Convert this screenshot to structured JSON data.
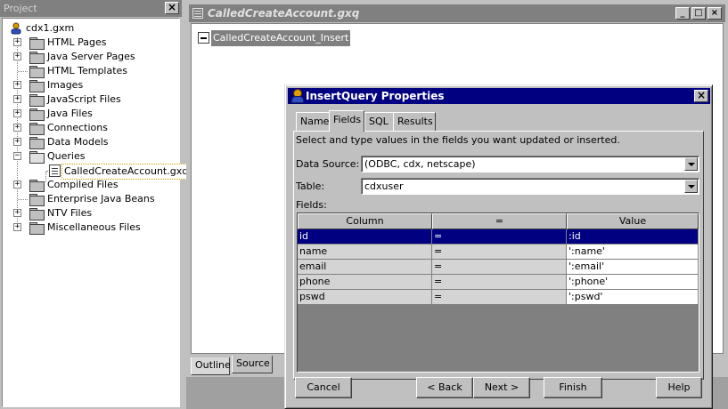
{
  "project": {
    "title": "Project",
    "root_label": "cdx1.gxm",
    "items": [
      {
        "label": "HTML Pages",
        "expandable": true
      },
      {
        "label": "Java Server Pages",
        "expandable": true
      },
      {
        "label": "HTML Templates",
        "expandable": false
      },
      {
        "label": "Images",
        "expandable": true
      },
      {
        "label": "JavaScript Files",
        "expandable": true
      },
      {
        "label": "Java Files",
        "expandable": true
      },
      {
        "label": "Connections",
        "expandable": true
      },
      {
        "label": "Data Models",
        "expandable": true
      },
      {
        "label": "Queries",
        "expandable": true,
        "open": true
      },
      {
        "label": "Compiled Files",
        "expandable": true
      },
      {
        "label": "Enterprise Java Beans",
        "expandable": false
      },
      {
        "label": "NTV Files",
        "expandable": true
      },
      {
        "label": "Miscellaneous Files",
        "expandable": true
      }
    ],
    "query_child": "CalledCreateAccount.gxq"
  },
  "editor": {
    "title": "CalledCreateAccount.gxq",
    "node_label": "CalledCreateAccount_Insert",
    "tabs": [
      "Outline",
      "Source"
    ],
    "window_buttons": [
      "_",
      "□",
      "×"
    ]
  },
  "dialog": {
    "title": "InsertQuery Properties",
    "tabs": [
      "Name",
      "Fields",
      "SQL",
      "Results"
    ],
    "active_tab": "Fields",
    "instruction": "Select and type values in the fields you want updated or inserted.",
    "data_source_label": "Data Source:",
    "data_source_value": "(ODBC, cdx, netscape)",
    "table_label": "Table:",
    "table_value": "cdxuser",
    "fields_label": "Fields:",
    "grid_headers": [
      "Column",
      "=",
      "Value"
    ],
    "rows": [
      {
        "column": "id",
        "op": "=",
        "value": ":id",
        "selected": true
      },
      {
        "column": "name",
        "op": "=",
        "value": "':name'"
      },
      {
        "column": "email",
        "op": "=",
        "value": "':email'"
      },
      {
        "column": "phone",
        "op": "=",
        "value": "':phone'"
      },
      {
        "column": "pswd",
        "op": "=",
        "value": "':pswd'"
      }
    ],
    "buttons": {
      "cancel": "Cancel",
      "back": "< Back",
      "next": "Next >",
      "finish": "Finish",
      "help": "Help"
    }
  }
}
